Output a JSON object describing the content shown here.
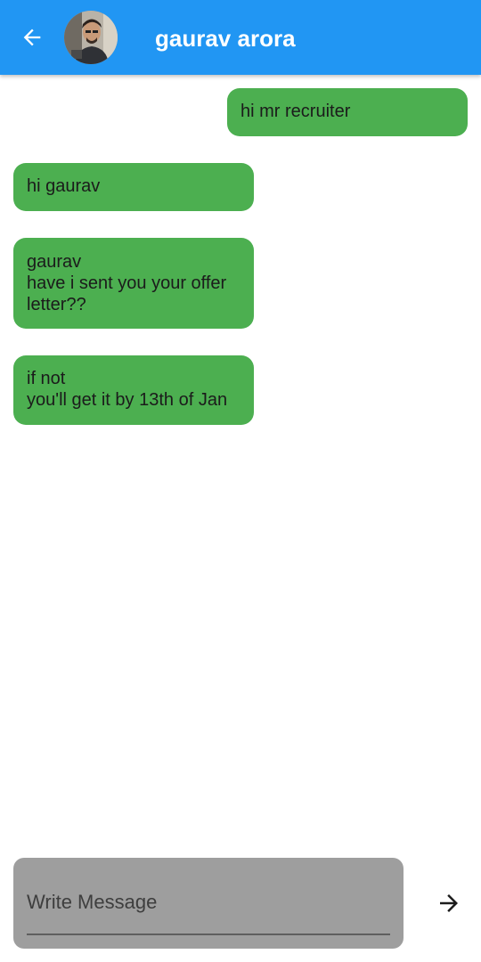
{
  "header": {
    "back_icon": "arrow-back-icon",
    "avatar": "profile-photo",
    "title": "gaurav arora",
    "background_color": "#2196f3"
  },
  "messages": [
    {
      "direction": "outgoing",
      "text": "hi mr recruiter"
    },
    {
      "direction": "incoming",
      "text": "hi gaurav"
    },
    {
      "direction": "incoming",
      "text": "gaurav\nhave i sent you your offer letter??"
    },
    {
      "direction": "incoming",
      "text": "if not\nyou'll get it by 13th of Jan"
    }
  ],
  "bubble_color": "#4caf50",
  "composer": {
    "placeholder": "Write Message",
    "value": "",
    "send_icon": "arrow-forward-icon",
    "background_color": "#9e9e9e"
  }
}
